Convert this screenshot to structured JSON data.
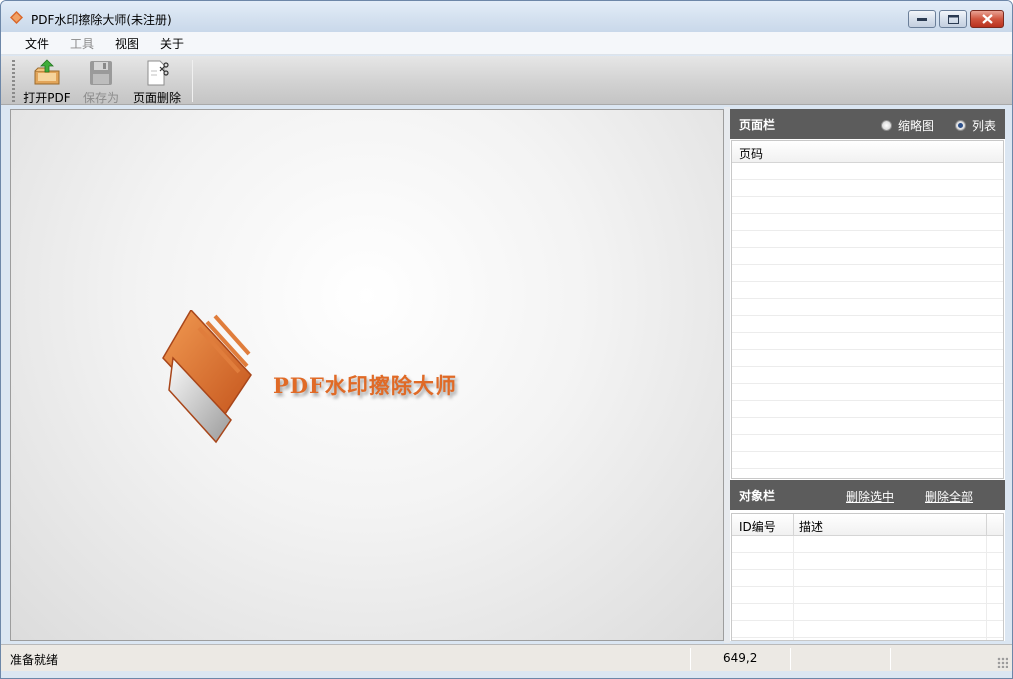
{
  "window": {
    "title": "PDF水印擦除大师(未注册)"
  },
  "menu": {
    "items": [
      {
        "label": "文件",
        "enabled": true
      },
      {
        "label": "工具",
        "enabled": false
      },
      {
        "label": "视图",
        "enabled": true
      },
      {
        "label": "关于",
        "enabled": true
      }
    ]
  },
  "toolbar": {
    "open_label": "打开PDF",
    "save_label": "保存为",
    "delete_page_label": "页面删除"
  },
  "canvas": {
    "logo_text": "PDF水印擦除大师"
  },
  "page_panel": {
    "title": "页面栏",
    "view_options": [
      {
        "label": "缩略图",
        "selected": false
      },
      {
        "label": "列表",
        "selected": true
      }
    ],
    "columns": [
      "页码"
    ]
  },
  "object_panel": {
    "title": "对象栏",
    "delete_selected": "删除选中",
    "delete_all": "删除全部",
    "columns": [
      "ID编号",
      "描述"
    ]
  },
  "status": {
    "message": "准备就绪",
    "coords": "649,2"
  },
  "colors": {
    "accent_orange": "#e06a26",
    "panel_header": "#5c5c5c"
  }
}
